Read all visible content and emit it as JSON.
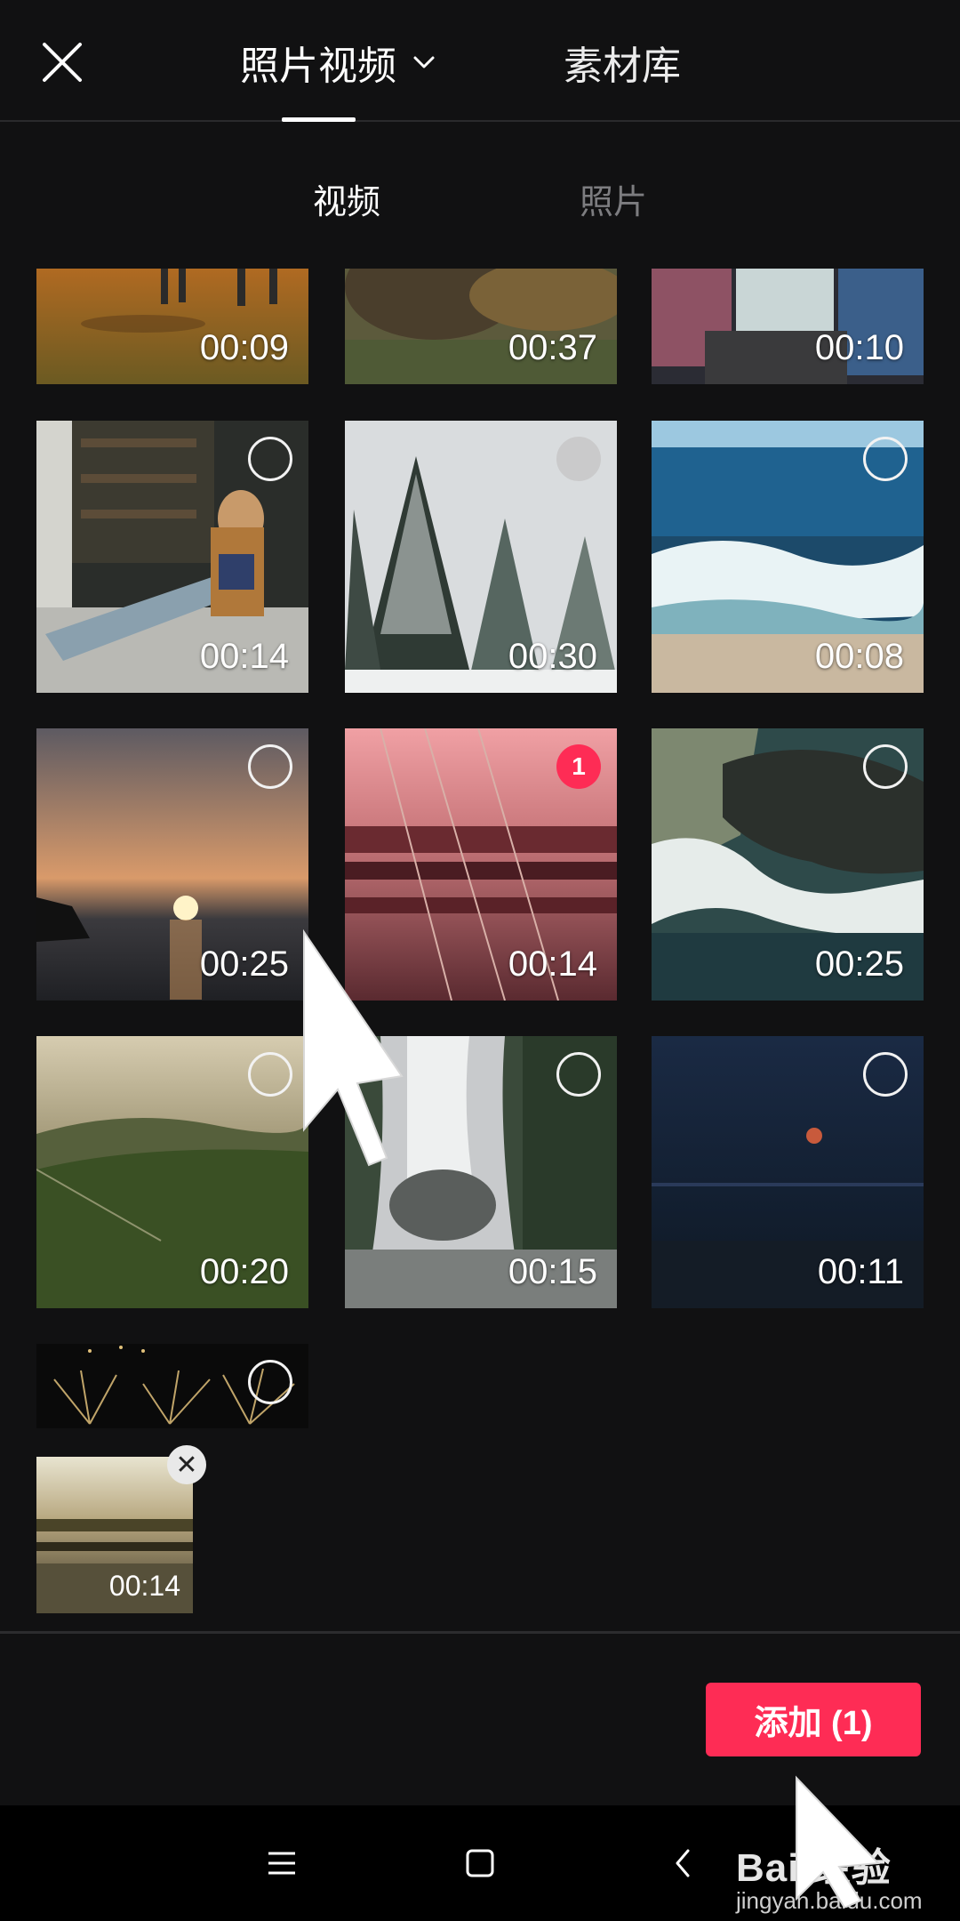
{
  "header": {
    "tab_photo_video": "照片视频",
    "tab_library": "素材库"
  },
  "subtabs": {
    "video": "视频",
    "photo": "照片"
  },
  "grid": [
    {
      "duration": "00:09"
    },
    {
      "duration": "00:37"
    },
    {
      "duration": "00:10"
    },
    {
      "duration": "00:14"
    },
    {
      "duration": "00:30"
    },
    {
      "duration": "00:08"
    },
    {
      "duration": "00:25"
    },
    {
      "duration": "00:14",
      "selected_index": "1"
    },
    {
      "duration": "00:25"
    },
    {
      "duration": "00:20"
    },
    {
      "duration": "00:15"
    },
    {
      "duration": "00:11"
    }
  ],
  "tray": {
    "duration": "00:14",
    "remove_glyph": "✕"
  },
  "add_button": "添加 (1)",
  "watermark": {
    "main": "Bai 经验",
    "sub": "jingyan.baidu.com"
  },
  "colors": {
    "accent": "#fe2c55",
    "background": "#111112"
  }
}
